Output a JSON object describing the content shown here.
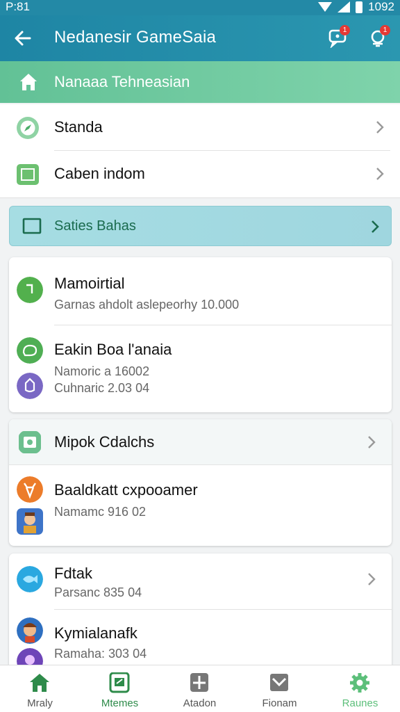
{
  "status_bar": {
    "time": "P:81",
    "battery": "1092"
  },
  "app_bar": {
    "title": "Nedanesir GameSaia",
    "badge_1": "1",
    "badge_2": "1"
  },
  "section_header": {
    "title": "Nanaaa Tehneasian"
  },
  "menu": [
    {
      "label": "Standa"
    },
    {
      "label": "Caben indom"
    }
  ],
  "highlight_item": {
    "label": "Saties Bahas"
  },
  "card1": {
    "items": [
      {
        "title": "Mamoirtial",
        "subs": [
          "Garnas ahdolt aslepeorhy 10.000"
        ]
      },
      {
        "title": "Eakin Boa l'anaia",
        "subs": [
          "Namoric a 16002",
          "Cuhnaric 2.03 04"
        ]
      }
    ]
  },
  "card2": {
    "header": "Mipok Cdalchs",
    "items": [
      {
        "title": "Baaldkatt cxpooamer",
        "subs": [
          "Namamc 916 02"
        ]
      }
    ]
  },
  "card3": {
    "items": [
      {
        "title": "Fdtak",
        "subs": [
          "Parsanc 835 04"
        ]
      },
      {
        "title": "Kymialanafk",
        "subs": [
          "Ramaha: 303 04"
        ]
      }
    ]
  },
  "bottom_nav": [
    {
      "label": "Mraly",
      "icon": "home-icon",
      "color": "#2e8b4a"
    },
    {
      "label": "Mtemes",
      "icon": "card-icon",
      "color": "#2e8b4a"
    },
    {
      "label": "Atadon",
      "icon": "grid-icon",
      "color": "#777777"
    },
    {
      "label": "Fionam",
      "icon": "mail-icon",
      "color": "#777777"
    },
    {
      "label": "Raunes",
      "icon": "gear-icon",
      "color": "#5cbf7a"
    }
  ],
  "colors": {
    "app_bar": "#1e85a4",
    "section_header": "#62c196",
    "highlight": "#a6dde3",
    "accent_green": "#2e8b4a"
  }
}
